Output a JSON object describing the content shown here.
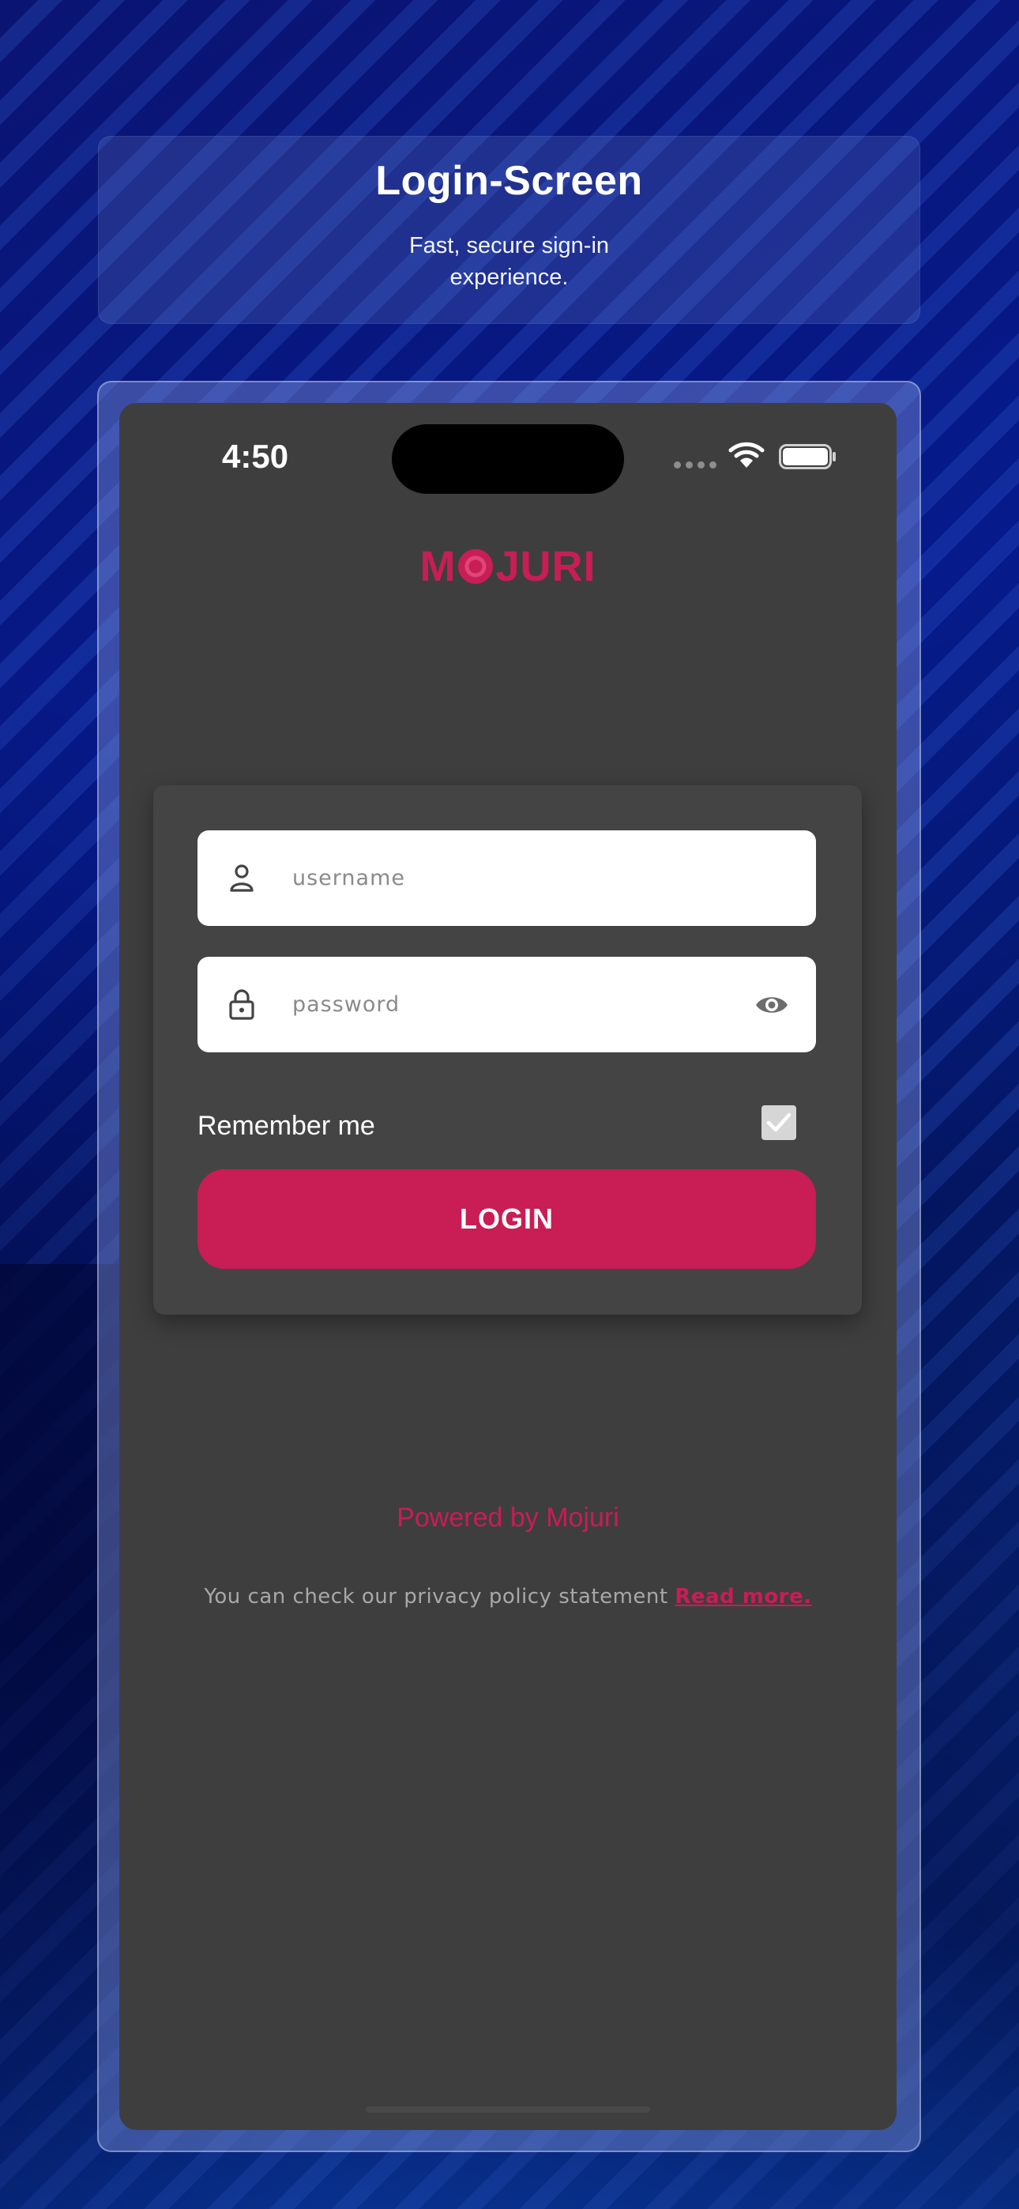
{
  "header": {
    "title": "Login-Screen",
    "subtitle_line1": "Fast, secure sign-in",
    "subtitle_line2": "experience."
  },
  "status_bar": {
    "time": "4:50",
    "icons": [
      "signal-dots-icon",
      "wifi-icon",
      "battery-icon"
    ]
  },
  "brand": {
    "logo_text_left": "M",
    "logo_text_right": "JURI",
    "color": "#c81d55"
  },
  "form": {
    "username": {
      "placeholder": "username",
      "value": "",
      "icon": "user-icon"
    },
    "password": {
      "placeholder": "password",
      "value": "",
      "icon": "lock-icon",
      "toggle_icon": "eye-icon"
    },
    "remember_label": "Remember me",
    "remember_checked": true,
    "login_label": "LOGIN"
  },
  "footer": {
    "powered_by": "Powered by Mojuri",
    "privacy_text": "You can check our privacy policy statement ",
    "privacy_link": "Read more."
  },
  "colors": {
    "accent": "#c81d55",
    "screen_bg": "#3f3e3f",
    "card_bg": "#454445"
  }
}
